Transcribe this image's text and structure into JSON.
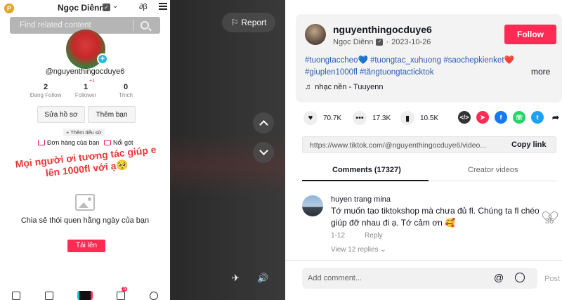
{
  "phone": {
    "coin_label": "P",
    "display_name": "Ngọc Diênn",
    "search_placeholder": "Find related content",
    "username": "@nguyenthingocduye6",
    "stats": [
      {
        "value": "2",
        "label": "Đang Follow",
        "badge": ""
      },
      {
        "value": "1",
        "label": "Follower",
        "badge": "+1"
      },
      {
        "value": "0",
        "label": "Thích",
        "badge": ""
      }
    ],
    "edit_profile": "Sửa hồ sơ",
    "add_friends": "Thêm bạn",
    "add_bio": "+ Thêm tiểu sử",
    "orders": "Đơn hàng của bạn",
    "highlights": "Nổi gót",
    "overlay_text": "Mọi người ơi tương tác giúp e lên 1000fl với ạ🥺",
    "empty_title": "Chia sẻ thói quen hằng ngày của bạn",
    "upload": "Tải lên",
    "notif_badge": "5"
  },
  "player": {
    "report": "Report"
  },
  "post": {
    "username": "nguyenthingocduye6",
    "display_name": "Ngọc Diênn",
    "date": "2023-10-26",
    "follow": "Follow",
    "hashtags": "#tuongtaccheo💙 #tuongtac_xuhuong #saochepkienket❤️ #giuplen1000fl #tăngtuongtacticktok",
    "more": "more",
    "music": "nhạc nền - Tuuyenn",
    "likes": "70.7K",
    "comments": "17.3K",
    "saves": "10.5K",
    "share_colors": {
      "embed": "#333333",
      "send": "#fe2c55",
      "facebook": "#1877f2",
      "whatsapp": "#25d366",
      "twitter": "#1da1f2"
    },
    "link": "https://www.tiktok.com/@nguyenthingocduye6/video...",
    "copy_link": "Copy link",
    "tab_comments": "Comments (17327)",
    "tab_creator": "Creator videos"
  },
  "comment": {
    "user": "huyen trang mina",
    "text": "Tớ muốn tạo tiktokshop mà chưa đủ fl. Chúng ta fl chéo giúp đỡ nhau đi ạ. Tớ cảm ơn 🥰",
    "date": "1-12",
    "reply": "Reply",
    "likes": "36",
    "view_replies": "View 12 replies"
  },
  "comment_bar": {
    "placeholder": "Add comment...",
    "at": "@",
    "post": "Post"
  }
}
